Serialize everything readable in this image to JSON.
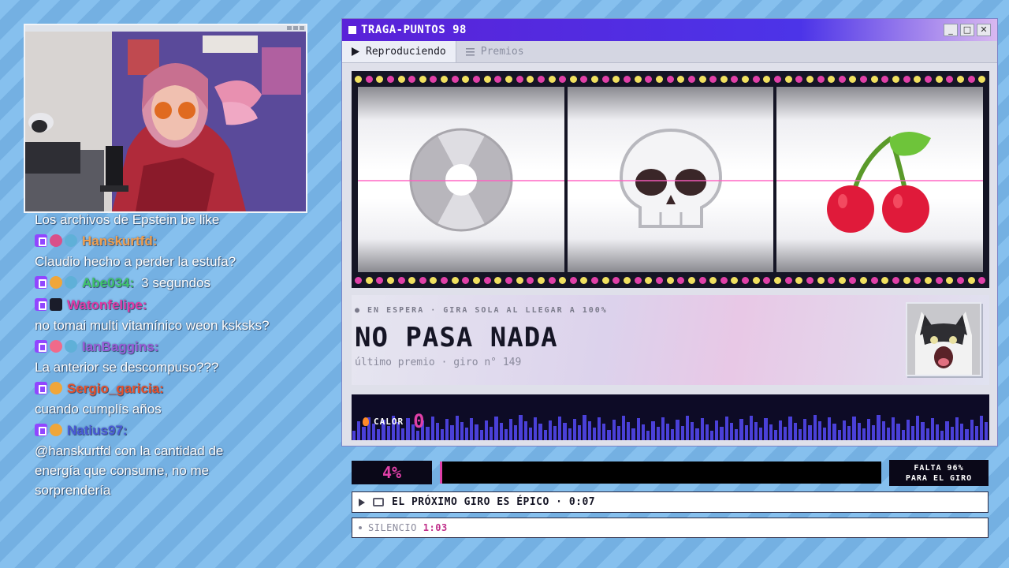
{
  "chat": {
    "messages": [
      {
        "user": "",
        "badges": [],
        "text": "Los archivos de Epstein be like"
      },
      {
        "user": "Hanskurtfd:",
        "user_color": "#f0a050",
        "badges": [
          "twitch-badge",
          "heart-badge",
          "cat-badge"
        ],
        "text": "Claudio hecho a perder la estufa?"
      },
      {
        "user": "Abe034:",
        "user_color": "#3ec46a",
        "badges": [
          "twitch-badge",
          "crown-badge",
          "cat-badge"
        ],
        "text": "3 segundos",
        "inline": true
      },
      {
        "user": "Watonfelipe:",
        "user_color": "#e03aa6",
        "badges": [
          "twitch-badge",
          "dark-badge"
        ],
        "text": "no tomai multi vitamínico weon ksksks?"
      },
      {
        "user": "IanBaggins:",
        "user_color": "#9a5cd8",
        "badges": [
          "twitch-badge",
          "face-badge",
          "cat-badge"
        ],
        "text": "La anterior se descompuso???"
      },
      {
        "user": "Sergio_garicia:",
        "user_color": "#e8502a",
        "badges": [
          "twitch-badge",
          "crown-badge"
        ],
        "text": "cuando cumplís años"
      },
      {
        "user": "Natius97:",
        "user_color": "#4a5ad8",
        "badges": [
          "twitch-badge",
          "crown-badge"
        ],
        "text": "@hanskurtfd con la cantidad de energía que consume, no me sorprendería"
      }
    ]
  },
  "window": {
    "title": "TRAGA-PUNTOS 98",
    "controls": [
      "_",
      "□",
      "✕"
    ],
    "tabs": [
      {
        "label": "Reproduciendo",
        "icon": "play-icon",
        "active": true
      },
      {
        "label": "Premios",
        "icon": "list-icon",
        "active": false
      }
    ]
  },
  "reels": [
    "vinyl-disc-icon",
    "skull-icon",
    "cherries-icon"
  ],
  "status": {
    "line": "● EN ESPERA · GIRA SOLA AL LLEGAR A 100%",
    "title": "NO PASA NADA",
    "subtitle": "último premio · giro n° 149"
  },
  "heat": {
    "label": "CALOR",
    "value": "0"
  },
  "progress": {
    "percent_label": "4%",
    "fraction": 0.004,
    "remaining_line1": "FALTA 96%",
    "remaining_line2": "PARA EL GIRO"
  },
  "ticker": {
    "text": "EL PRÓXIMO GIRO ES ÉPICO · 0:07"
  },
  "silence": {
    "label": "SILENCIO",
    "time": "1:03"
  },
  "colors": {
    "accent": "#e040a8",
    "title_gradient_start": "#5a22d8",
    "dark": "#0a0818"
  }
}
